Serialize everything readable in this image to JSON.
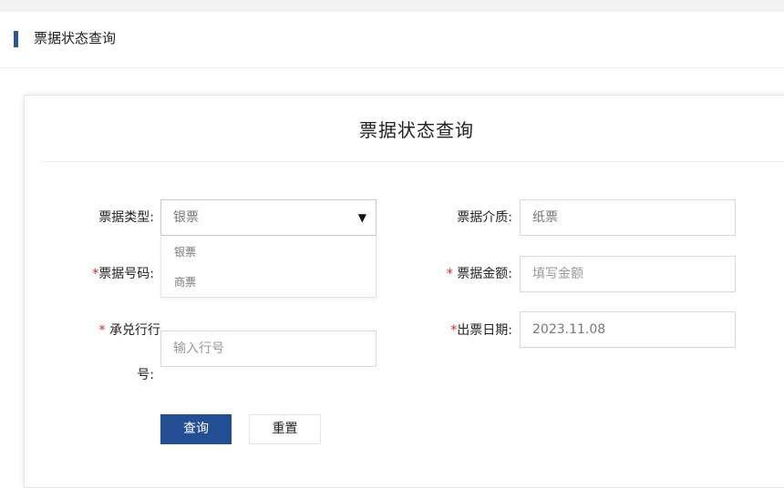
{
  "header": {
    "title": "票据状态查询"
  },
  "form": {
    "title": "票据状态查询",
    "bill_type": {
      "label": "票据类型:",
      "value": "银票",
      "options": [
        "银票",
        "商票"
      ]
    },
    "bill_medium": {
      "label": "票据介质:",
      "value": "纸票"
    },
    "bill_number": {
      "required_mark": "*",
      "label": "票据号码:"
    },
    "bill_amount": {
      "required_mark": "* ",
      "label": "票据金额:",
      "placeholder": "填写金额"
    },
    "acceptor_bank": {
      "required_mark": "* ",
      "label_line1": "承兑行行",
      "label_line2": "号:",
      "placeholder": "输入行号"
    },
    "issue_date": {
      "required_mark": "*",
      "label": "出票日期:",
      "value": "2023.11.08"
    }
  },
  "buttons": {
    "query": "查询",
    "reset": "重置"
  },
  "colors": {
    "accent": "#254f94",
    "required": "#e02020"
  },
  "icons": {
    "caret": "caret-down-icon"
  }
}
